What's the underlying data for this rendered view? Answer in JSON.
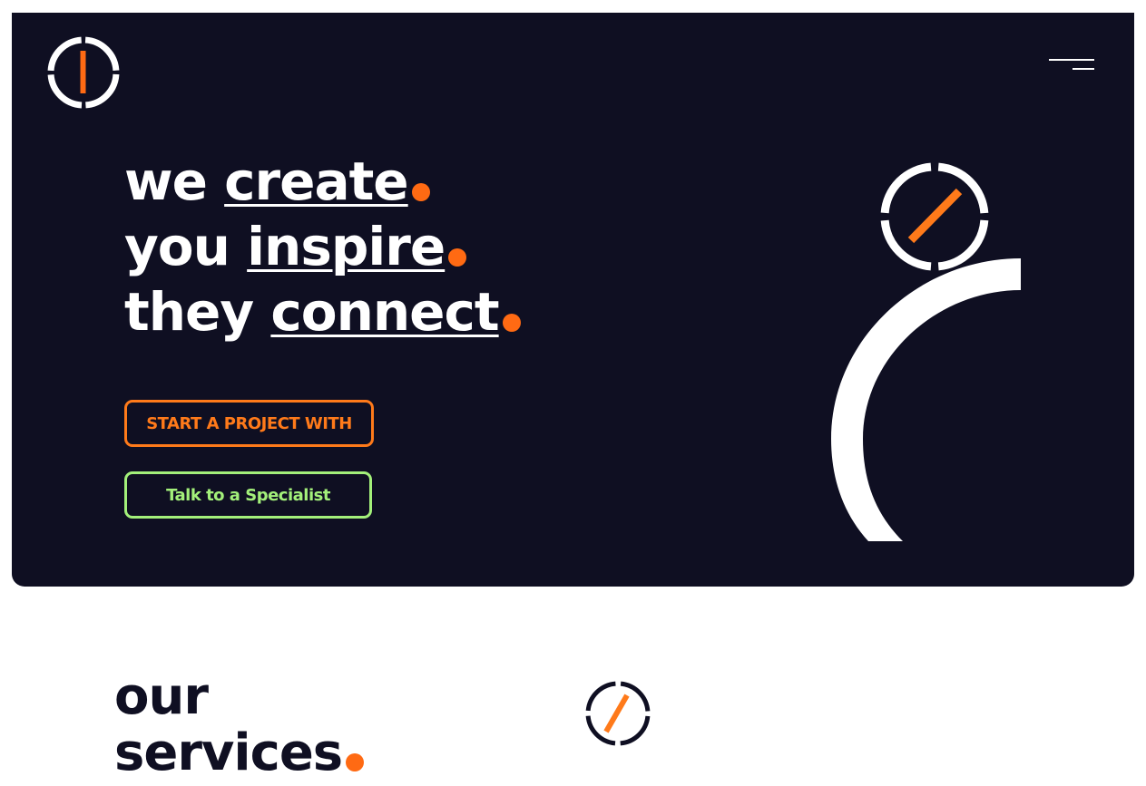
{
  "colors": {
    "background_dark": "#0f0f22",
    "accent_orange": "#ff6a13",
    "button_orange": "#ff7a1a",
    "accent_green": "#a3f07a",
    "white": "#ffffff"
  },
  "header": {
    "logo_icon": "logo-ring-icon",
    "menu_icon": "hamburger-menu-icon"
  },
  "hero": {
    "lines": [
      {
        "lead": "we",
        "emphasis": "create"
      },
      {
        "lead": "you",
        "emphasis": "inspire"
      },
      {
        "lead": "they",
        "emphasis": "connect"
      }
    ],
    "buttons": {
      "project_label": "START A PROJECT WITH",
      "specialist_label": "Talk to a Specialist"
    },
    "decorations": [
      "ring-slash-icon",
      "white-arc-shape"
    ]
  },
  "services": {
    "title_line1": "our",
    "title_line2": "services",
    "icon": "ring-slash-icon"
  }
}
